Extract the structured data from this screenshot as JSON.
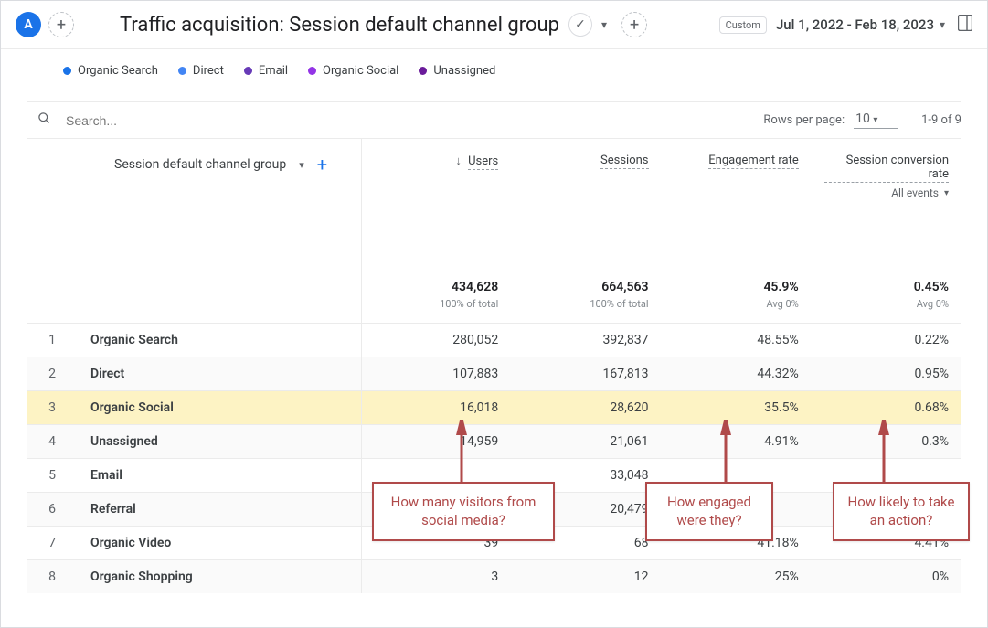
{
  "header": {
    "avatar_letter": "A",
    "title": "Traffic acquisition: Session default channel group",
    "custom_label": "Custom",
    "date_range": "Jul 1, 2022 - Feb 18, 2023"
  },
  "legend": [
    {
      "label": "Organic Search",
      "color": "#1a73e8"
    },
    {
      "label": "Direct",
      "color": "#4285f4"
    },
    {
      "label": "Email",
      "color": "#673ab7"
    },
    {
      "label": "Organic Social",
      "color": "#9334e6"
    },
    {
      "label": "Unassigned",
      "color": "#6a1b9a"
    }
  ],
  "search": {
    "placeholder": "Search..."
  },
  "pagination": {
    "rows_per_page_label": "Rows per page:",
    "rows_per_page_value": "10",
    "range": "1-9 of 9"
  },
  "columns": {
    "dimension": "Session default channel group",
    "users": "Users",
    "sessions": "Sessions",
    "engagement": "Engagement rate",
    "conversion": "Session conversion rate",
    "conversion_sub": "All events"
  },
  "totals": {
    "users": "434,628",
    "users_sub": "100% of total",
    "sessions": "664,563",
    "sessions_sub": "100% of total",
    "engagement": "45.9%",
    "engagement_sub": "Avg 0%",
    "conversion": "0.45%",
    "conversion_sub": "Avg 0%"
  },
  "rows": [
    {
      "idx": "1",
      "name": "Organic Search",
      "users": "280,052",
      "sessions": "392,837",
      "eng": "48.55%",
      "conv": "0.22%",
      "hl": false
    },
    {
      "idx": "2",
      "name": "Direct",
      "users": "107,883",
      "sessions": "167,813",
      "eng": "44.32%",
      "conv": "0.95%",
      "hl": false
    },
    {
      "idx": "3",
      "name": "Organic Social",
      "users": "16,018",
      "sessions": "28,620",
      "eng": "35.5%",
      "conv": "0.68%",
      "hl": true
    },
    {
      "idx": "4",
      "name": "Unassigned",
      "users": "14,959",
      "sessions": "21,061",
      "eng": "4.91%",
      "conv": "0.3%",
      "hl": false
    },
    {
      "idx": "5",
      "name": "Email",
      "users": "",
      "sessions": "33,048",
      "eng": "",
      "conv": "",
      "hl": false
    },
    {
      "idx": "6",
      "name": "Referral",
      "users": "",
      "sessions": "20,479",
      "eng": "",
      "conv": "",
      "hl": false
    },
    {
      "idx": "7",
      "name": "Organic Video",
      "users": "39",
      "sessions": "68",
      "eng": "41.18%",
      "conv": "4.41%",
      "hl": false
    },
    {
      "idx": "8",
      "name": "Organic Shopping",
      "users": "3",
      "sessions": "12",
      "eng": "25%",
      "conv": "0%",
      "hl": false
    }
  ],
  "annotations": {
    "a1": "How many visitors from social media?",
    "a2": "How engaged were they?",
    "a3": "How likely to take an action?"
  }
}
